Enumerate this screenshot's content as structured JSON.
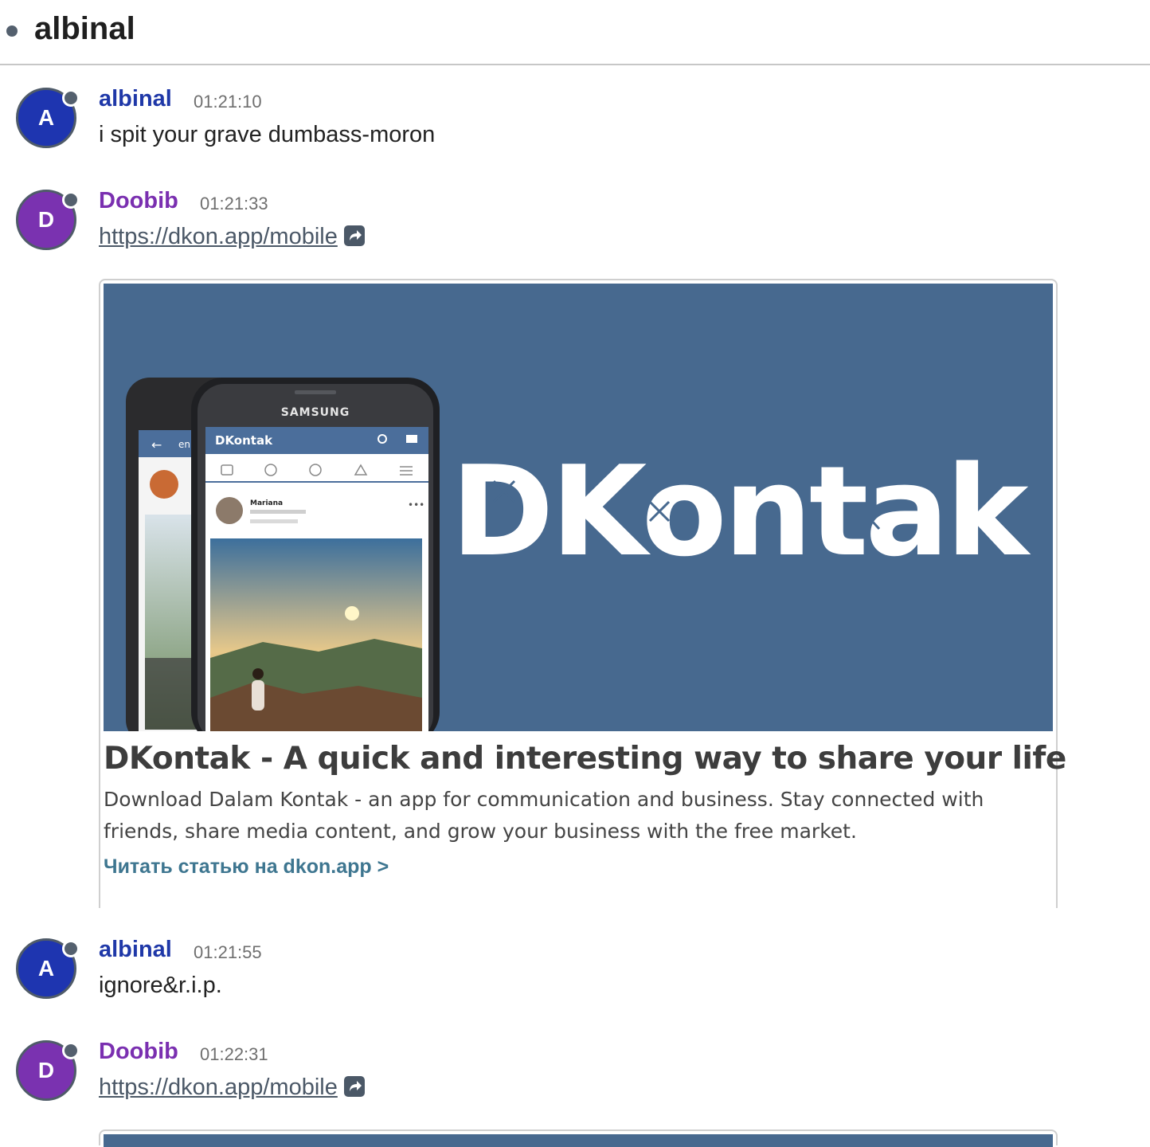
{
  "header": {
    "title": "albinal"
  },
  "messages": [
    {
      "author": "albinal",
      "initial": "A",
      "time": "01:21:10",
      "text": "i spit your grave dumbass-moron",
      "color": "#1e35b0",
      "name_color": "#1f38a8"
    },
    {
      "author": "Doobib",
      "initial": "D",
      "time": "01:21:33",
      "text": "https://dkon.app/mobile",
      "color": "#7a32b0",
      "name_color": "#7a2fb0"
    },
    {
      "author": "albinal",
      "initial": "A",
      "time": "01:21:55",
      "text": "ignore&r.i.p.",
      "color": "#1e35b0",
      "name_color": "#1f38a8"
    },
    {
      "author": "Doobib",
      "initial": "D",
      "time": "01:22:31",
      "text": "https://dkon.app/mobile",
      "color": "#7a32b0",
      "name_color": "#7a2fb0"
    }
  ],
  "embed": {
    "title": "DKontak - A quick and interesting way to share your life",
    "description": "Download Dalam Kontak - an app for communication and business. Stay connected with friends, share media content, and grow your business with the free market.",
    "read_more": "Читать статью на dkon.app >",
    "image": {
      "logo_text": "DKontak",
      "phone_brand": "SAMSUNG",
      "app_name": "DKontak",
      "post_author": "Mariana",
      "back_text": "en",
      "background": "#47698f"
    }
  },
  "icons": {
    "external_link": "external-link-icon"
  }
}
